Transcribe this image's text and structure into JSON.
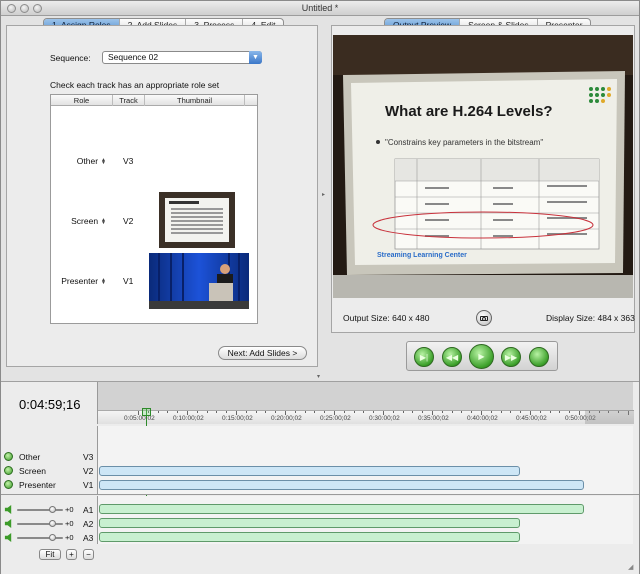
{
  "window": {
    "title": "Untitled *"
  },
  "wizard_tabs": [
    "1. Assign Roles",
    "2. Add Slides",
    "3. Process",
    "4. Edit"
  ],
  "sequence": {
    "label": "Sequence:",
    "value": "Sequence 02"
  },
  "instruction": "Check each track has an appropriate role set",
  "role_table": {
    "headers": {
      "role": "Role",
      "track": "Track",
      "thumbnail": "Thumbnail"
    },
    "rows": [
      {
        "role": "Other",
        "track": "V3"
      },
      {
        "role": "Screen",
        "track": "V2"
      },
      {
        "role": "Presenter",
        "track": "V1"
      }
    ]
  },
  "next_button": "Next: Add Slides >",
  "preview_tabs": [
    "Output Preview",
    "Screen & Slides",
    "Presenter"
  ],
  "slide": {
    "title": "What are H.264 Levels?",
    "bullet": "\"Constrains key parameters in the bitstream\"",
    "footer": "Streaming Learning Center"
  },
  "output_size": "Output Size: 640 x 480",
  "display_size": "Display Size: 484 x 363",
  "timecode": "0:04:59;16",
  "ruler_labels": [
    "0:05:00;02",
    "0:10:00;02",
    "0:15:00;02",
    "0:20:00;02",
    "0:25:00;02",
    "0:30:00;02",
    "0:35:00;02",
    "0:40:00;02",
    "0:45:00;02",
    "0:50:00;02"
  ],
  "video_tracks": [
    {
      "name": "Other",
      "id": "V3"
    },
    {
      "name": "Screen",
      "id": "V2"
    },
    {
      "name": "Presenter",
      "id": "V1"
    }
  ],
  "audio_tracks": [
    {
      "id": "A1",
      "gain": "+0"
    },
    {
      "id": "A2",
      "gain": "+0"
    },
    {
      "id": "A3",
      "gain": "+0"
    }
  ],
  "zoom_controls": {
    "fit": "Fit",
    "plus": "+",
    "minus": "−"
  },
  "icons": {
    "camera": "camera-icon",
    "play": "play-icon",
    "rewind": "rewind-icon",
    "fast_forward": "fast-forward-icon",
    "step_back": "step-back-icon",
    "loop": "loop-icon",
    "eye": "eye-icon",
    "speaker": "speaker-icon"
  }
}
